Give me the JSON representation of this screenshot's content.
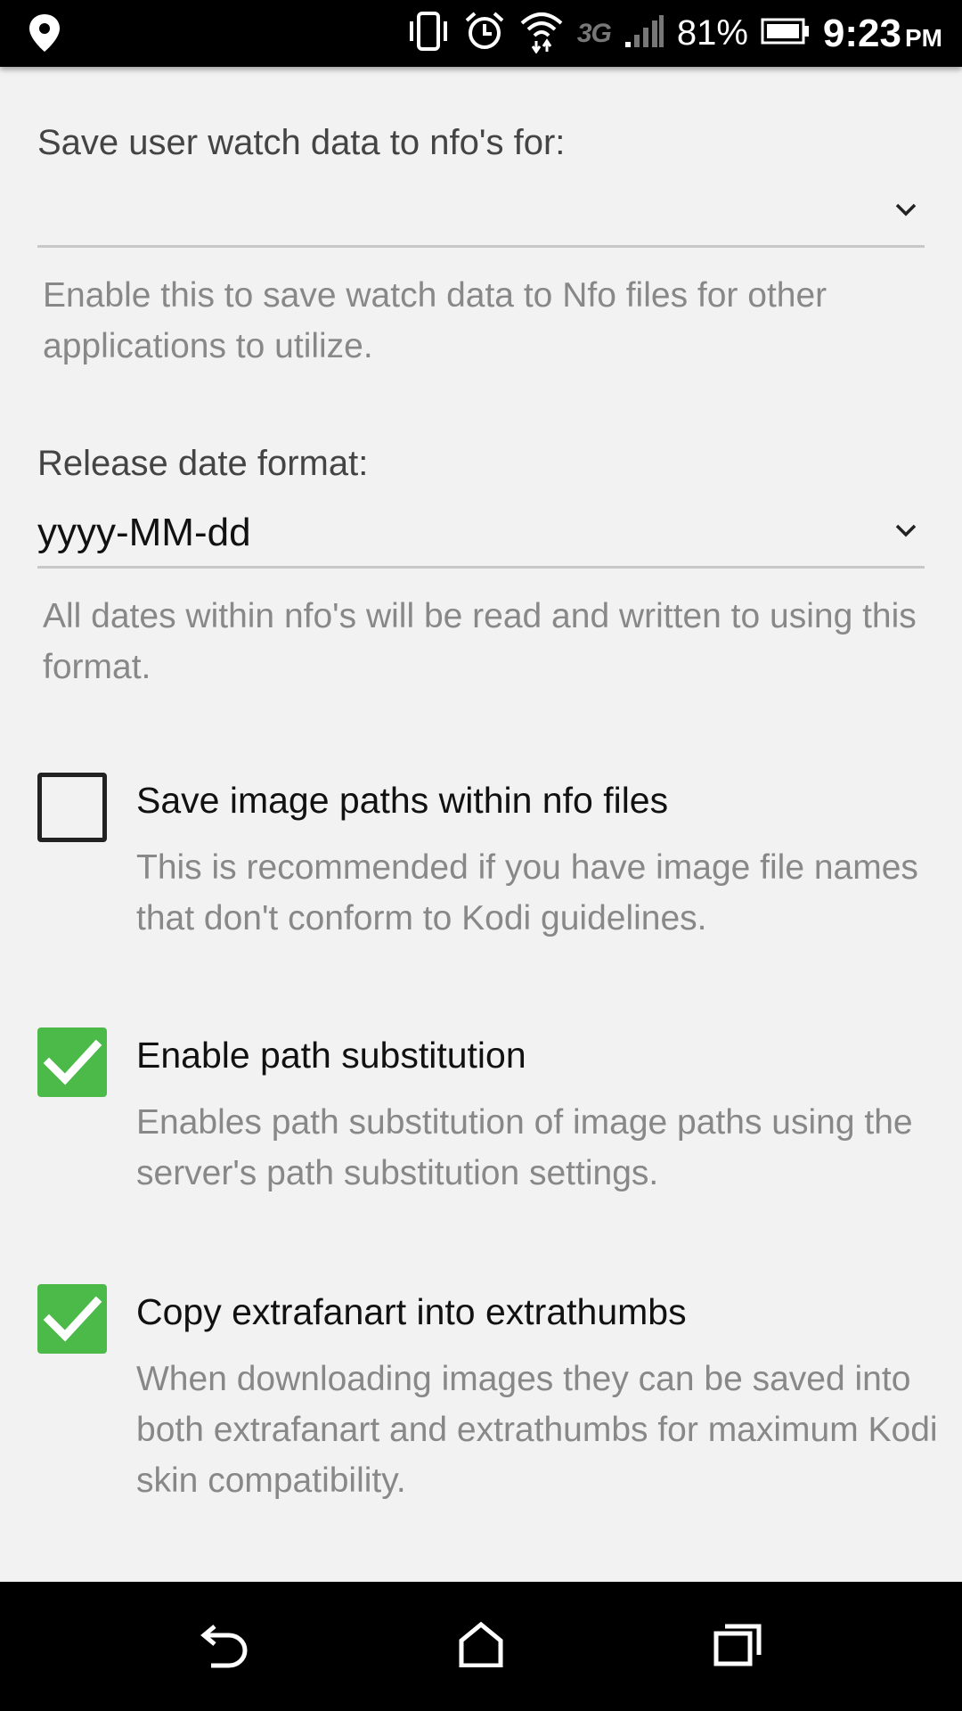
{
  "status_bar": {
    "icons": [
      "location-pin-icon",
      "vibrate-icon",
      "alarm-icon",
      "wifi-icon",
      "signal-icon",
      "battery-icon"
    ],
    "network_type": "3G",
    "battery_percent": "81%",
    "time": "9:23",
    "am_pm": "PM"
  },
  "settings": {
    "watch_data": {
      "label": "Save user watch data to nfo's for:",
      "value": "",
      "help": "Enable this to save watch data to Nfo files for other applications to utilize."
    },
    "release_date": {
      "label": "Release date format:",
      "value": "yyyy-MM-dd",
      "help": "All dates within nfo's will be read and written to using this format."
    },
    "save_image_paths": {
      "title": "Save image paths within nfo files",
      "description": "This is recommended if you have image file names that don't conform to Kodi guidelines.",
      "checked": false
    },
    "path_substitution": {
      "title": "Enable path substitution",
      "description": "Enables path substitution of image paths using the server's path substitution settings.",
      "checked": true
    },
    "copy_extrafanart": {
      "title": "Copy extrafanart into extrathumbs",
      "description": "When downloading images they can be saved into both extrafanart and extrathumbs for maximum Kodi skin compatibility.",
      "checked": true
    }
  },
  "colors": {
    "accent_check": "#4cba48",
    "background": "#f2f2f2",
    "help_text": "#888888"
  },
  "nav_bar": {
    "buttons": [
      "back-icon",
      "home-icon",
      "recent-apps-icon"
    ]
  }
}
